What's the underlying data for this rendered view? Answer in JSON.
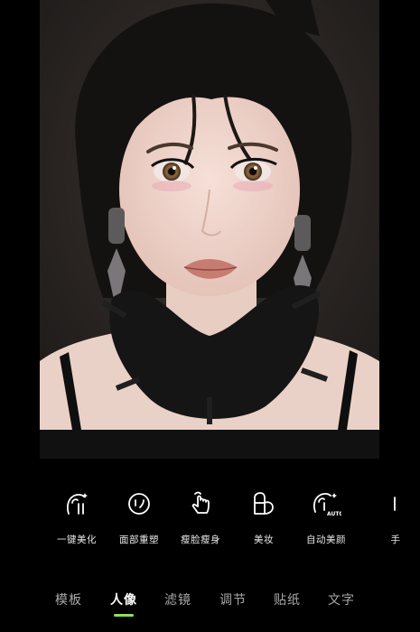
{
  "colors": {
    "background": "#000000",
    "accent": "#8fe05a",
    "tab_inactive": "#a9a9a9",
    "tab_active": "#ffffff"
  },
  "photo": {
    "description_icon": "portrait-photo"
  },
  "tools": [
    {
      "label": "一键美化",
      "icon": "face-sparkle-icon"
    },
    {
      "label": "面部重塑",
      "icon": "face-reshape-icon"
    },
    {
      "label": "瘦脸瘦身",
      "icon": "hand-pointer-icon"
    },
    {
      "label": "美妆",
      "icon": "makeup-icon"
    },
    {
      "label": "自动美颜",
      "icon": "auto-beauty-icon"
    },
    {
      "label": "手",
      "icon": "partial-tool-icon"
    }
  ],
  "tabs": [
    {
      "label": "模板",
      "active": false
    },
    {
      "label": "人像",
      "active": true
    },
    {
      "label": "滤镜",
      "active": false
    },
    {
      "label": "调节",
      "active": false
    },
    {
      "label": "贴纸",
      "active": false
    },
    {
      "label": "文字",
      "active": false
    }
  ]
}
